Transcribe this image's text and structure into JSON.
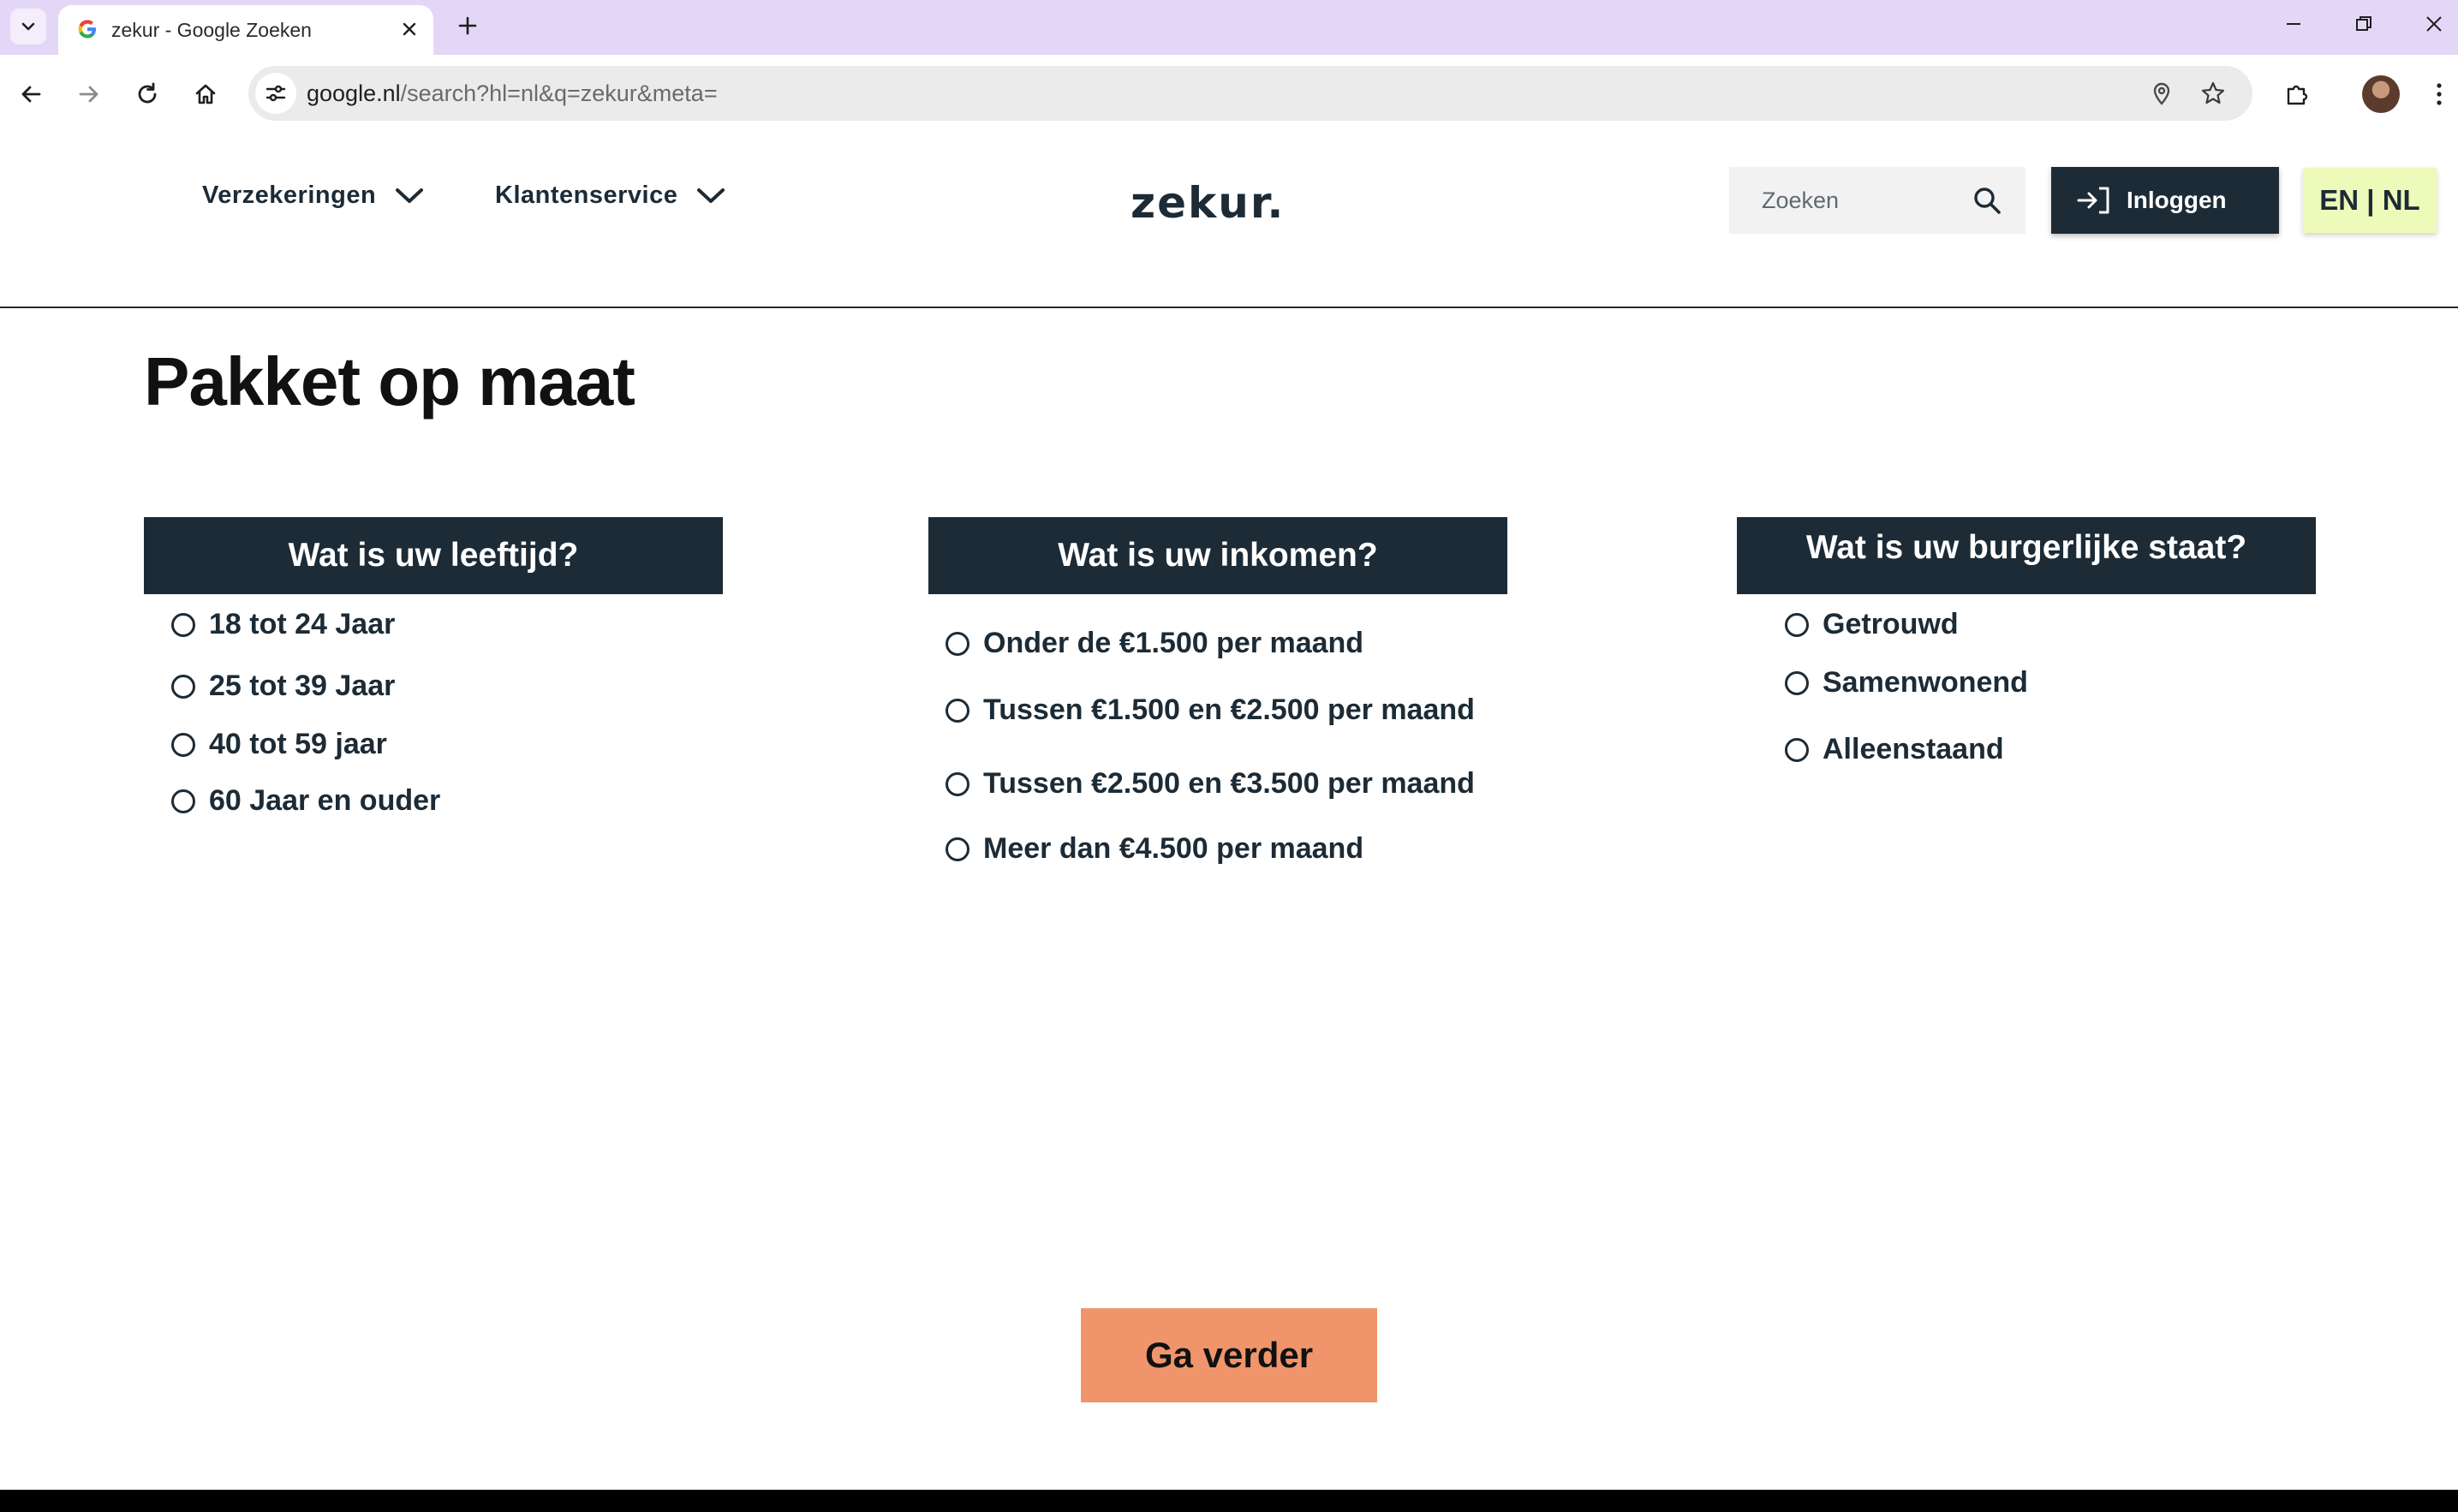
{
  "browser": {
    "tab_title": "zekur - Google Zoeken",
    "url_domain": "google.nl",
    "url_path": "/search?hl=nl&q=zekur&meta="
  },
  "site": {
    "nav": {
      "insurance_label": "Verzekeringen",
      "service_label": "Klantenservice"
    },
    "logo_text": "zekur.",
    "search_placeholder": "Zoeken",
    "login_label": "Inloggen",
    "lang_label": "EN | NL"
  },
  "page": {
    "title": "Pakket op maat",
    "questions": [
      {
        "heading": "Wat is uw leeftijd?",
        "options": [
          "18 tot 24 Jaar",
          "25 tot 39 Jaar",
          "40 tot 59 jaar",
          "60 Jaar en ouder"
        ]
      },
      {
        "heading": "Wat is uw inkomen?",
        "options": [
          "Onder de €1.500 per maand",
          "Tussen €1.500 en €2.500 per maand",
          "Tussen €2.500 en €3.500 per maand",
          "Meer dan €4.500 per maand"
        ]
      },
      {
        "heading": "Wat is uw burgerlijke staat?",
        "options": [
          "Getrouwd",
          "Samenwonend",
          "Alleenstaand"
        ]
      }
    ],
    "continue_label": "Ga verder"
  },
  "colors": {
    "brand_dark": "#1c2b36",
    "cta": "#f0956b",
    "lang_bg": "#eefab9",
    "tabbar": "#e3d7f7"
  }
}
